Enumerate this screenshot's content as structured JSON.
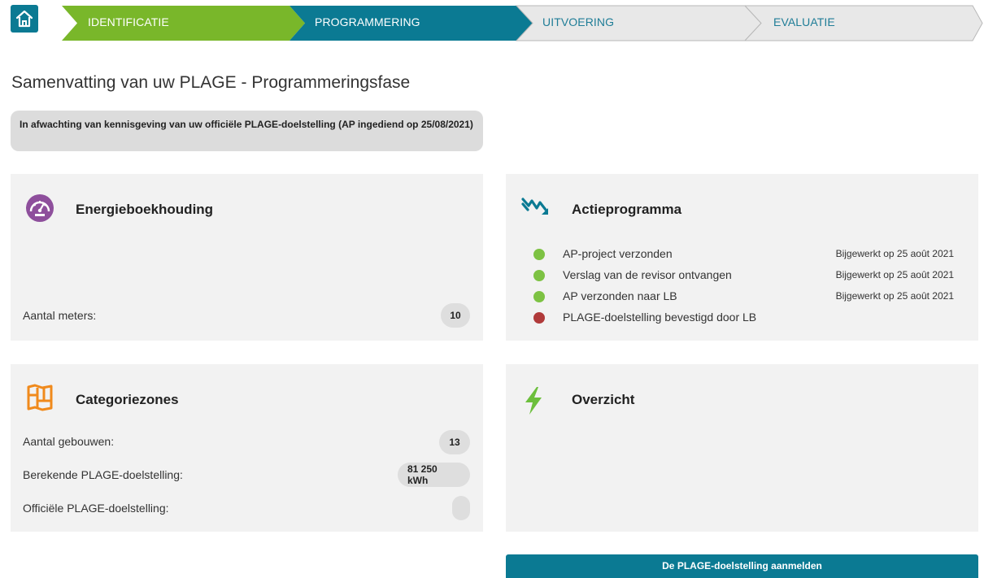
{
  "stepper": {
    "steps": [
      {
        "label": "IDENTIFICATIE",
        "state": "done",
        "color": "#79b72a"
      },
      {
        "label": "PROGRAMMERING",
        "state": "current",
        "color": "#0b7a93"
      },
      {
        "label": "UITVOERING",
        "state": "upcoming",
        "color": "#e8e8e8"
      },
      {
        "label": "EVALUATIE",
        "state": "upcoming",
        "color": "#e8e8e8"
      }
    ]
  },
  "page": {
    "title": "Samenvatting van uw PLAGE - Programmeringsfase",
    "status": "In afwachting van kennisgeving van uw officiële PLAGE-doelstelling (AP ingediend op 25/08/2021)"
  },
  "energy": {
    "title": "Energieboekhouding",
    "icon": "gauge-icon",
    "meters_label": "Aantal meters:",
    "meters_value": "10"
  },
  "action_program": {
    "title": "Actieprogramma",
    "icon": "descending-trend-icon",
    "items": [
      {
        "label": "AP-project verzonden",
        "date": "Bijgewerkt op 25 août 2021",
        "status_color": "#7dc243"
      },
      {
        "label": "Verslag van de revisor ontvangen",
        "date": "Bijgewerkt op 25 août 2021",
        "status_color": "#7dc243"
      },
      {
        "label": "AP verzonden naar LB",
        "date": "Bijgewerkt op 25 août 2021",
        "status_color": "#7dc243"
      },
      {
        "label": "PLAGE-doelstelling bevestigd door LB",
        "date": "",
        "status_color": "#b03a3a"
      }
    ]
  },
  "zones": {
    "title": "Categoriezones",
    "icon": "map-icon",
    "buildings_label": "Aantal gebouwen:",
    "buildings_value": "13",
    "computed_label": "Berekende PLAGE-doelstelling:",
    "computed_value": "81 250 kWh",
    "official_label": "Officiële PLAGE-doelstelling:",
    "official_value": ""
  },
  "overview": {
    "title": "Overzicht",
    "icon": "lightning-icon"
  },
  "actions": {
    "submit_label": "De PLAGE-doelstelling aanmelden"
  },
  "colors": {
    "accent": "#0b7a93",
    "done_green": "#79b72a",
    "energy_purple": "#8e4f9c",
    "zones_orange": "#f08a1c",
    "bolt_green": "#6cbf3c"
  }
}
